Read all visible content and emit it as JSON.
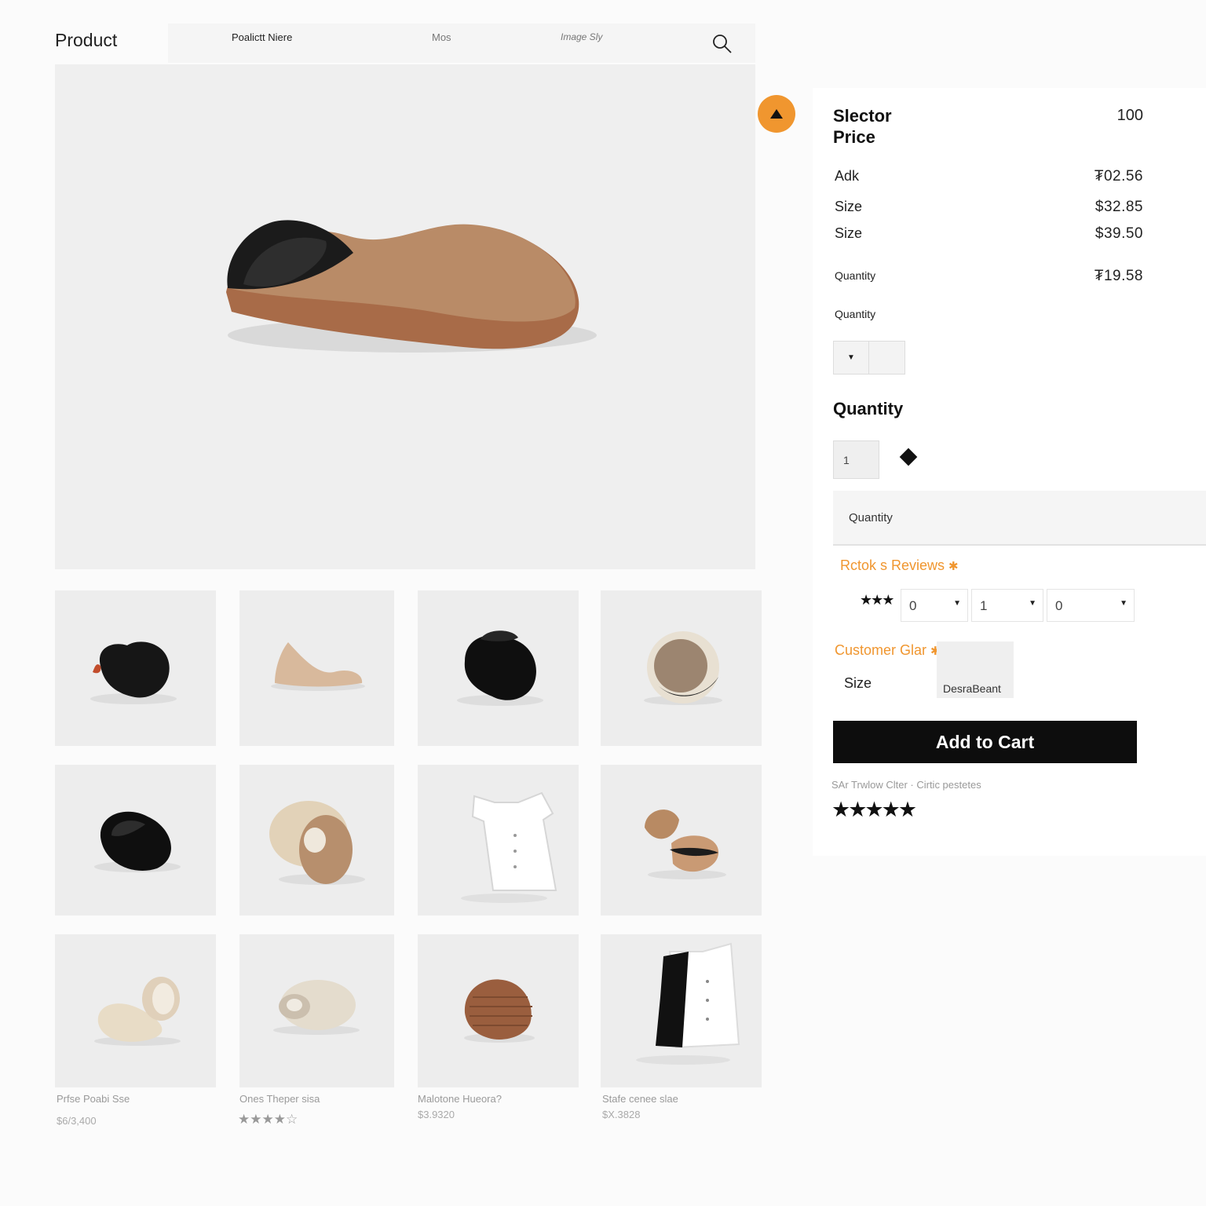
{
  "header": {
    "title": "Product",
    "nav": [
      "Poalictt Niere",
      "Mos",
      "Image Sly"
    ]
  },
  "panel": {
    "title_line1": "Slector",
    "title_line2": "Price",
    "top_value": "100",
    "rows": [
      {
        "label": "Adk",
        "value": "₮02.56"
      },
      {
        "label": "Size",
        "value": "$32.85"
      },
      {
        "label": "Size",
        "value": "$39.50"
      },
      {
        "label": "Quantity",
        "value": "₮19.58"
      }
    ],
    "quantity_label_small": "Quantity",
    "quantity_heading": "Quantity",
    "quantity_value": "1",
    "quantity_bar_label": "Quantity",
    "reviews_label": "Rctok s Reviews",
    "review_selects": [
      "0",
      "1",
      "0"
    ],
    "customer_label": "Customer Glar",
    "size_label": "Size",
    "desc_label": "DesraBeant",
    "cart_label": "Add to Cart",
    "tiny_text": "SAr Trwlow Clter · Cirtic pestetes",
    "stars_rating": "★★★★★",
    "stars_small": "★★★"
  },
  "products": [
    {
      "caption": "Prfse Poabi Sse",
      "price": "$6/3,400"
    },
    {
      "caption": "Ones Theper sisa",
      "price": "★★★★☆"
    },
    {
      "caption": "Malotone Hueora?",
      "price": "$3.9320"
    },
    {
      "caption": "Stafe cenee slae",
      "price": "$X.3828"
    }
  ],
  "icons": {
    "search": "search-icon",
    "upload": "triangle-up-icon",
    "dropdown": "chevron-down-icon",
    "star": "star-icon"
  },
  "colors": {
    "accent": "#f0962f",
    "button": "#0d0d0d",
    "tan": "#b88a63"
  }
}
